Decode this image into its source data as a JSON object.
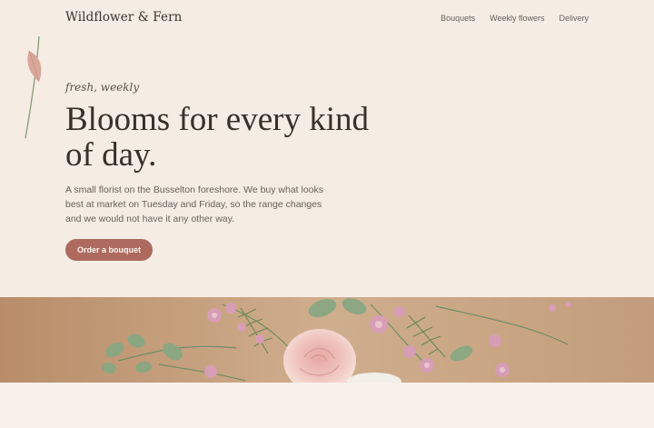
{
  "header": {
    "brand": "Wildflower & Fern",
    "nav": [
      {
        "label": "Bouquets"
      },
      {
        "label": "Weekly flowers"
      },
      {
        "label": "Delivery"
      }
    ]
  },
  "hero": {
    "eyebrow": "fresh, weekly",
    "headline": "Blooms for every kind of day.",
    "lede": "A small florist on the Busselton foreshore. We buy what looks best at market on Tuesday and Friday, so the range changes and we would not have it any other way.",
    "cta_label": "Order a bouquet"
  },
  "colors": {
    "background": "#f5ece4",
    "accent": "#ae6a5f",
    "heading": "#3a2f29",
    "body_text": "#6a5f58"
  },
  "icons": [
    "leaf-stem-icon"
  ]
}
